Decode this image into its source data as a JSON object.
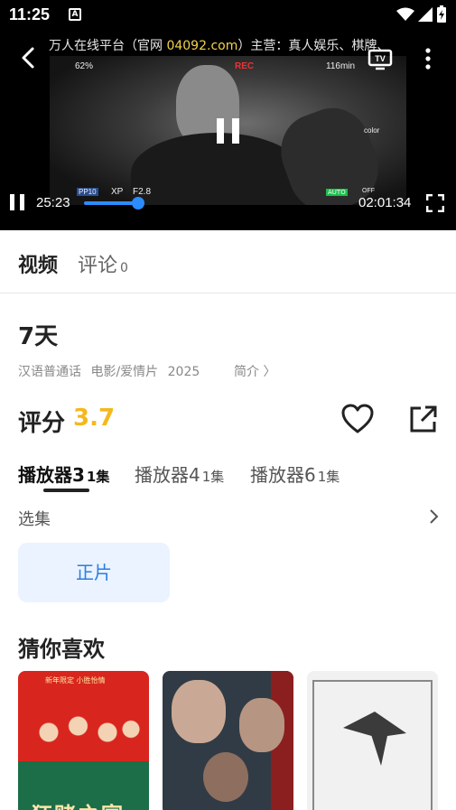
{
  "status_bar": {
    "time": "11:25",
    "notification_icon_letter": "A",
    "icons": [
      "wifi-icon",
      "signal-icon",
      "battery-charging-icon"
    ]
  },
  "player": {
    "watermark_prefix": "万人在线平台（官网 ",
    "watermark_site": "04092.com",
    "watermark_suffix": "）主营：真人娱乐、棋牌、",
    "current_time": "25:23",
    "total_time": "02:01:34",
    "progress_fraction": 0.21,
    "hud": {
      "battery": "62%",
      "rec": "REC",
      "remaining": "116min",
      "pp": "PP10",
      "xp": "XP",
      "fstop": "F2.8",
      "auto": "AUTO",
      "off": "OFF",
      "color": "color"
    },
    "icons": {
      "back": "back-arrow-icon",
      "tv": "tv-cast-icon",
      "more": "more-vertical-icon",
      "pause": "pause-icon",
      "fullscreen": "fullscreen-icon"
    }
  },
  "tabs": {
    "video_label": "视频",
    "comment_label": "评论",
    "comment_count": "0"
  },
  "movie": {
    "title": "7天",
    "language": "汉语普通话",
    "genre": "电影/爱情片",
    "year": "2025",
    "intro_label": "简介 〉",
    "score_label": "评分",
    "score_value": "3.7"
  },
  "player_sources": [
    {
      "label": "播放器3",
      "count": "1集",
      "active": true
    },
    {
      "label": "播放器4",
      "count": "1集",
      "active": false
    },
    {
      "label": "播放器6",
      "count": "1集",
      "active": false
    }
  ],
  "episodes": {
    "label": "选集",
    "items": [
      "正片"
    ]
  },
  "recommend": {
    "title": "猜你喜欢",
    "poster1_top": "新年限定 小胜怡情",
    "poster1_title": "狂赌之宴"
  },
  "colors": {
    "accent_blue": "#2b8cff",
    "score_yellow": "#f5b81c",
    "chip_bg": "#eaf3ff",
    "chip_text": "#2a7de1",
    "watermark_site": "#f3d34a"
  }
}
